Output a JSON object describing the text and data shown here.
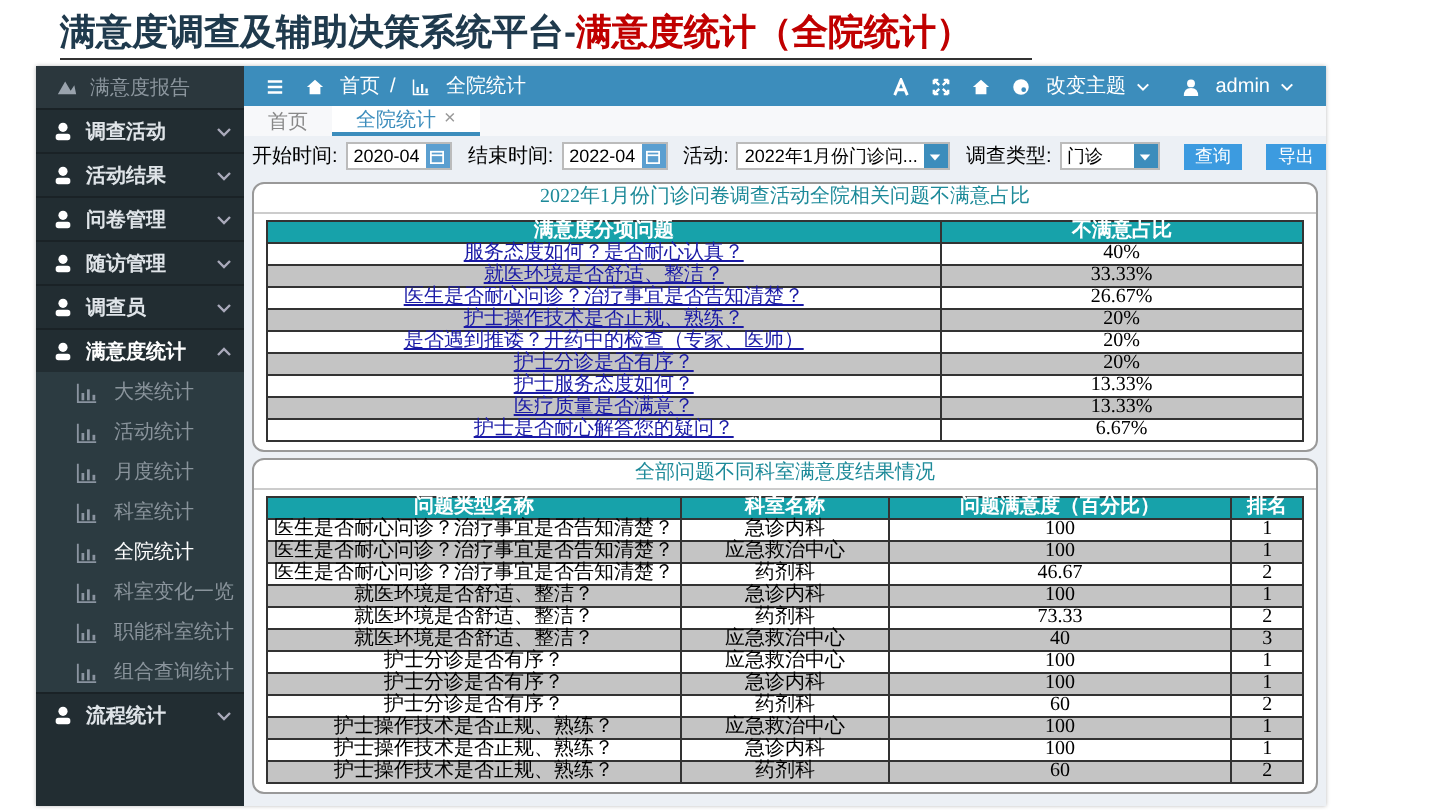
{
  "slide_title": {
    "main": "满意度调查及辅助决策系统平台-",
    "highlight": "满意度统计（全院统计）"
  },
  "sidebar": {
    "brand": "满意度报告",
    "items": [
      {
        "label": "调查活动",
        "expanded": false
      },
      {
        "label": "活动结果",
        "expanded": false
      },
      {
        "label": "问卷管理",
        "expanded": false
      },
      {
        "label": "随访管理",
        "expanded": false
      },
      {
        "label": "调查员",
        "expanded": false
      },
      {
        "label": "满意度统计",
        "expanded": true,
        "children": [
          {
            "label": "大类统计",
            "selected": false
          },
          {
            "label": "活动统计",
            "selected": false
          },
          {
            "label": "月度统计",
            "selected": false
          },
          {
            "label": "科室统计",
            "selected": false
          },
          {
            "label": "全院统计",
            "selected": true
          },
          {
            "label": "科室变化一览",
            "selected": false
          },
          {
            "label": "职能科室统计",
            "selected": false
          },
          {
            "label": "组合查询统计",
            "selected": false
          }
        ]
      },
      {
        "label": "流程统计",
        "expanded": false
      }
    ]
  },
  "topbar": {
    "breadcrumb": [
      "首页",
      "全院统计"
    ],
    "separator": "/",
    "theme": "改变主题",
    "user": "admin"
  },
  "tabs": [
    {
      "label": "首页",
      "selected": false
    },
    {
      "label": "全院统计",
      "selected": true,
      "close": "×"
    }
  ],
  "filters": [
    {
      "kind": "date",
      "label": "开始时间:",
      "value": "2020-04"
    },
    {
      "kind": "date",
      "label": "结束时间:",
      "value": "2022-04"
    },
    {
      "kind": "select",
      "label": "活动:",
      "value": "2022年1月份门诊问..."
    },
    {
      "kind": "select",
      "label": "调查类型:",
      "value": "门诊"
    }
  ],
  "buttons": [
    "查询",
    "导出"
  ],
  "table_1": {
    "title": "2022年1月份门诊问卷调查活动全院相关问题不满意占比",
    "columns": [
      "满意度分项问题",
      "不满意占比"
    ],
    "rows": [
      [
        "服务态度如何？是否耐心认真？",
        "40%"
      ],
      [
        "就医环境是否舒适、整洁？",
        "33.33%"
      ],
      [
        "医生是否耐心问诊？治疗事宜是否告知清楚？",
        "26.67%"
      ],
      [
        "护士操作技术是否正规、熟练？",
        "20%"
      ],
      [
        "是否遇到推诿？开药中的检查（专家、医师）",
        "20%"
      ],
      [
        "护士分诊是否有序？",
        "20%"
      ],
      [
        "护士服务态度如何？",
        "13.33%"
      ],
      [
        "医疗质量是否满意？",
        "13.33%"
      ],
      [
        "护士是否耐心解答您的疑问？",
        "6.67%"
      ]
    ]
  },
  "table_2": {
    "title": "全部问题不同科室满意度结果情况",
    "columns": [
      "问题类型名称",
      "科室名称",
      "问题满意度（百分比）",
      "排名"
    ],
    "rows": [
      [
        "医生是否耐心问诊？治疗事宜是否告知清楚？",
        "急诊内科",
        "100",
        "1"
      ],
      [
        "医生是否耐心问诊？治疗事宜是否告知清楚？",
        "应急救治中心",
        "100",
        "1"
      ],
      [
        "医生是否耐心问诊？治疗事宜是否告知清楚？",
        "药剂科",
        "46.67",
        "2"
      ],
      [
        "就医环境是否舒适、整洁？",
        "急诊内科",
        "100",
        "1"
      ],
      [
        "就医环境是否舒适、整洁？",
        "药剂科",
        "73.33",
        "2"
      ],
      [
        "就医环境是否舒适、整洁？",
        "应急救治中心",
        "40",
        "3"
      ],
      [
        "护士分诊是否有序？",
        "应急救治中心",
        "100",
        "1"
      ],
      [
        "护士分诊是否有序？",
        "急诊内科",
        "100",
        "1"
      ],
      [
        "护士分诊是否有序？",
        "药剂科",
        "60",
        "2"
      ],
      [
        "护士操作技术是否正规、熟练？",
        "应急救治中心",
        "100",
        "1"
      ],
      [
        "护士操作技术是否正规、熟练？",
        "急诊内科",
        "100",
        "1"
      ],
      [
        "护士操作技术是否正规、熟练？",
        "药剂科",
        "60",
        "2"
      ]
    ]
  }
}
